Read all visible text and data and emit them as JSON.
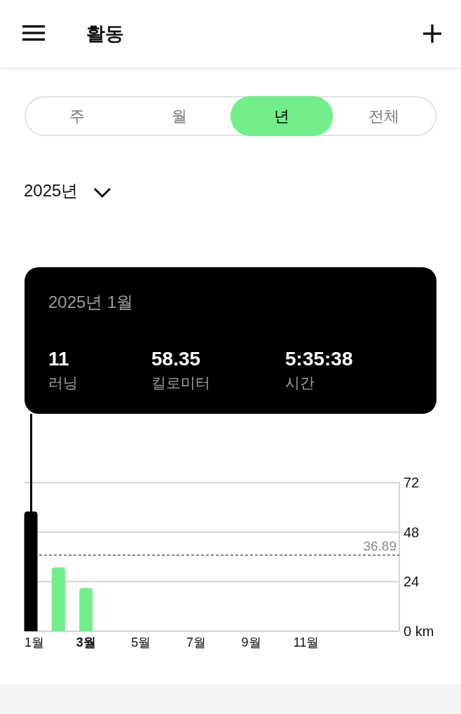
{
  "header": {
    "title": "활동"
  },
  "tabs": [
    {
      "label": "주",
      "selected": false
    },
    {
      "label": "월",
      "selected": false
    },
    {
      "label": "년",
      "selected": true
    },
    {
      "label": "전체",
      "selected": false
    }
  ],
  "year_selector": {
    "label": "2025년"
  },
  "tooltip": {
    "title": "2025년 1월",
    "stats": [
      {
        "value": "11",
        "label": "러닝"
      },
      {
        "value": "58.35",
        "label": "킬로미터"
      },
      {
        "value": "5:35:38",
        "label": "시간"
      }
    ]
  },
  "activity_chart": {
    "chart_data": {
      "type": "bar",
      "x": [
        1,
        2,
        3
      ],
      "series": [
        {
          "color": "#000000",
          "values": [
            58,
            null,
            null
          ]
        },
        {
          "color": "#72ee8b",
          "values": [
            null,
            31,
            21
          ]
        }
      ],
      "xlim": [
        0.77,
        14.38
      ],
      "xticks": [
        {
          "value": 1,
          "label": "1월"
        },
        {
          "value": 3,
          "label": "3월"
        },
        {
          "value": 5,
          "label": "5월"
        },
        {
          "value": 7,
          "label": "7월"
        },
        {
          "value": 9,
          "label": "9월"
        },
        {
          "value": 11,
          "label": "11월"
        }
      ],
      "ylim": [
        0,
        72
      ],
      "yticks": [
        {
          "value": 0,
          "label": "0 km"
        },
        24,
        48,
        72
      ],
      "ref_lines": [
        {
          "axis": "y",
          "value": 36.89,
          "label": "36.89",
          "color": "#555555"
        }
      ]
    },
    "xtick_current": [
      false,
      true,
      false,
      false,
      false,
      false
    ]
  }
}
